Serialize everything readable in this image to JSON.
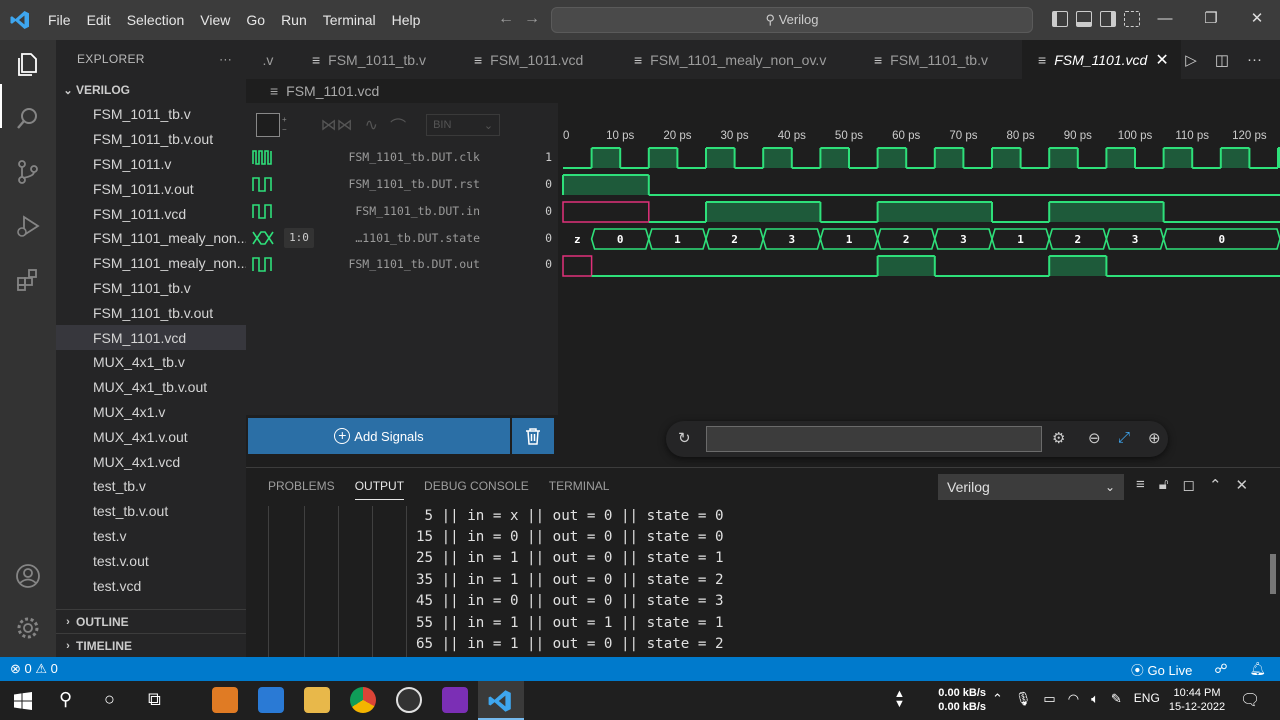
{
  "menu": [
    "File",
    "Edit",
    "Selection",
    "View",
    "Go",
    "Run",
    "Terminal",
    "Help"
  ],
  "command_center": "Verilog",
  "explorer": {
    "title": "EXPLORER",
    "folder": "VERILOG",
    "files": [
      "FSM_1011_tb.v",
      "FSM_1011_tb.v.out",
      "FSM_1011.v",
      "FSM_1011.v.out",
      "FSM_1011.vcd",
      "FSM_1101_mealy_non...",
      "FSM_1101_mealy_non...",
      "FSM_1101_tb.v",
      "FSM_1101_tb.v.out",
      "FSM_1101.vcd",
      "MUX_4x1_tb.v",
      "MUX_4x1_tb.v.out",
      "MUX_4x1.v",
      "MUX_4x1.v.out",
      "MUX_4x1.vcd",
      "test_tb.v",
      "test_tb.v.out",
      "test.v",
      "test.v.out",
      "test.vcd"
    ],
    "selected_file": "FSM_1101.vcd",
    "outline": "OUTLINE",
    "timeline": "TIMELINE"
  },
  "tabs": [
    ".v",
    "FSM_1011_tb.v",
    "FSM_1011.vcd",
    "FSM_1101_mealy_non_ov.v",
    "FSM_1101_tb.v",
    "FSM_1101.vcd"
  ],
  "active_tab": "FSM_1101.vcd",
  "breadcrumb": "FSM_1101.vcd",
  "waveform": {
    "format": "BIN",
    "time_ticks": [
      "0",
      "10 ps",
      "20 ps",
      "30 ps",
      "40 ps",
      "50 ps",
      "60 ps",
      "70 ps",
      "80 ps",
      "90 ps",
      "100 ps",
      "110 ps",
      "120 ps"
    ],
    "signals": [
      {
        "name": "FSM_1101_tb.DUT.clk",
        "value": "1"
      },
      {
        "name": "FSM_1101_tb.DUT.rst",
        "value": "0"
      },
      {
        "name": "FSM_1101_tb.DUT.in",
        "value": "0"
      },
      {
        "name": "…1101_tb.DUT.state",
        "value": "0",
        "range": "1:0"
      },
      {
        "name": "FSM_1101_tb.DUT.out",
        "value": "0"
      }
    ],
    "state_values": [
      "z",
      "0",
      "1",
      "2",
      "3",
      "1",
      "2",
      "3",
      "1",
      "2",
      "3",
      "0"
    ],
    "add_signals": "Add Signals"
  },
  "panel": {
    "tabs": [
      "PROBLEMS",
      "OUTPUT",
      "DEBUG CONSOLE",
      "TERMINAL"
    ],
    "active_tab": "OUTPUT",
    "channel": "Verilog",
    "output_lines": [
      " 5 || in = x || out = 0 || state = 0",
      "15 || in = 0 || out = 0 || state = 0",
      "25 || in = 1 || out = 0 || state = 1",
      "35 || in = 1 || out = 0 || state = 2",
      "45 || in = 0 || out = 0 || state = 3",
      "55 || in = 1 || out = 1 || state = 1",
      "65 || in = 1 || out = 0 || state = 2"
    ]
  },
  "status": {
    "errors": "0",
    "warnings": "0",
    "go_live": "Go Live"
  },
  "taskbar": {
    "net_up": "0.00 kB/s",
    "net_down": "0.00 kB/s",
    "lang": "ENG",
    "time": "10:44 PM",
    "date": "15-12-2022"
  },
  "colors": {
    "accent": "#007acc",
    "wave_green": "#2ee07a",
    "wave_fill": "#1e5a3a",
    "wave_undefined": "#e0307a"
  }
}
